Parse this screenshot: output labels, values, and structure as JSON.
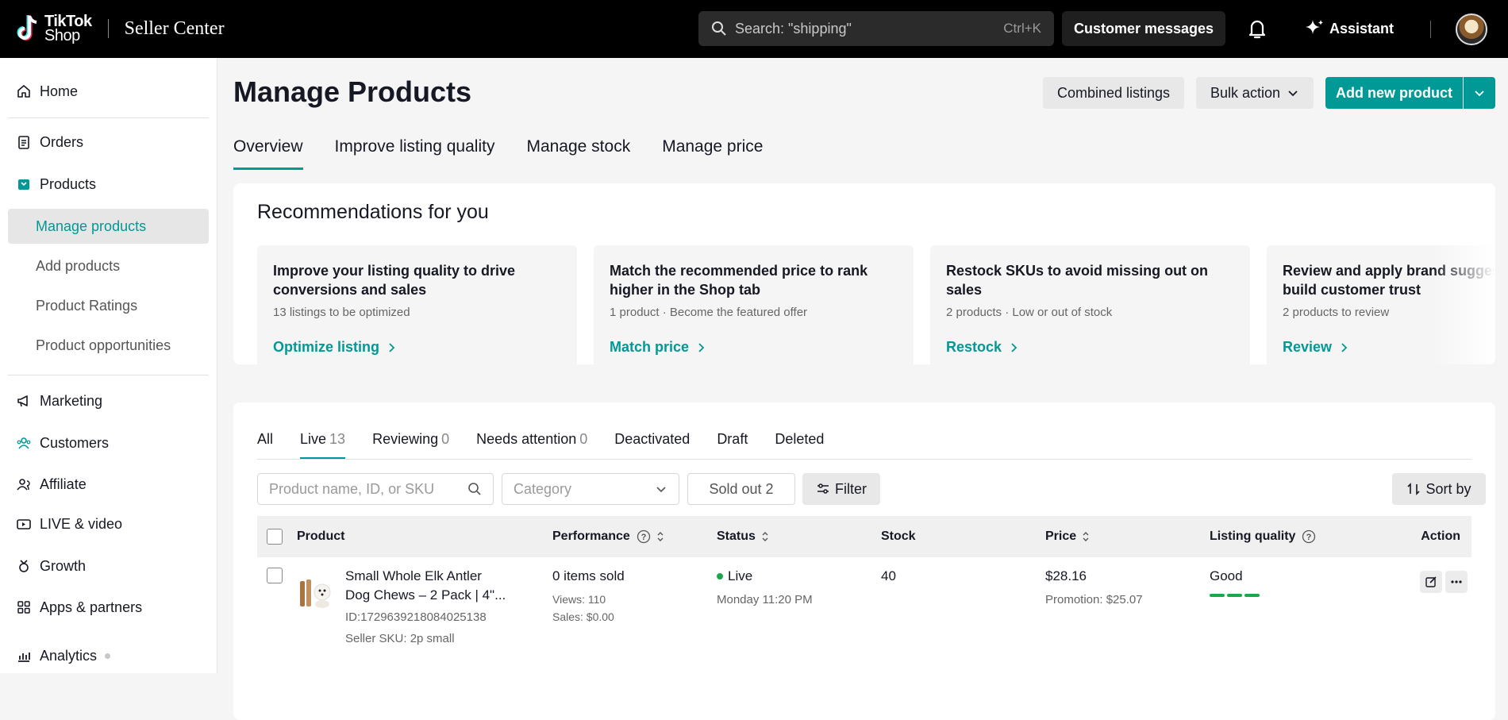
{
  "brand": {
    "logo_name": "TikTok",
    "logo_sub": "Shop",
    "app_name": "Seller Center",
    "accent": "#009995"
  },
  "topbar": {
    "search_placeholder": "Search: \"shipping\"",
    "search_shortcut": "Ctrl+K",
    "customer_messages": "Customer messages",
    "assistant": "Assistant"
  },
  "sidebar": {
    "home": "Home",
    "orders": "Orders",
    "products": "Products",
    "products_sub": [
      "Manage products",
      "Add products",
      "Product Ratings",
      "Product opportunities"
    ],
    "marketing": "Marketing",
    "customers": "Customers",
    "affiliate": "Affiliate",
    "live_video": "LIVE & video",
    "growth": "Growth",
    "apps_partners": "Apps & partners",
    "analytics": "Analytics"
  },
  "page": {
    "title": "Manage Products",
    "combined_listings": "Combined listings",
    "bulk_action": "Bulk action",
    "add_new_product": "Add new product",
    "tabs": [
      "Overview",
      "Improve listing quality",
      "Manage stock",
      "Manage price"
    ]
  },
  "recommendations": {
    "title": "Recommendations for you",
    "items": [
      {
        "heading": "Improve your listing quality to drive conversions and sales",
        "sub": "13 listings to be optimized",
        "link": "Optimize listing"
      },
      {
        "heading": "Match the recommended price to rank higher in the Shop tab",
        "sub": "1 product · Become the featured offer",
        "link": "Match price"
      },
      {
        "heading": "Restock SKUs to avoid missing out on sales",
        "sub": "2 products · Low or out of stock",
        "link": "Restock"
      },
      {
        "heading": "Review and apply brand suggestions to build customer trust",
        "sub": "2 products to review",
        "link": "Review"
      }
    ]
  },
  "list": {
    "status_tabs": [
      {
        "label": "All",
        "count": ""
      },
      {
        "label": "Live",
        "count": "13"
      },
      {
        "label": "Reviewing",
        "count": "0"
      },
      {
        "label": "Needs attention",
        "count": "0"
      },
      {
        "label": "Deactivated",
        "count": ""
      },
      {
        "label": "Draft",
        "count": ""
      },
      {
        "label": "Deleted",
        "count": ""
      }
    ],
    "search_placeholder": "Product name, ID, or SKU",
    "category_placeholder": "Category",
    "sold_out": "Sold out 2",
    "filter": "Filter",
    "sort_by": "Sort by",
    "columns": {
      "product": "Product",
      "performance": "Performance",
      "status": "Status",
      "stock": "Stock",
      "price": "Price",
      "listing_quality": "Listing quality",
      "action": "Action"
    },
    "rows": [
      {
        "name_line1": "Small Whole Elk Antler",
        "name_line2": "Dog Chews – 2 Pack | 4\"...",
        "id": "ID:1729639218084025138",
        "sku": "Seller SKU: 2p small",
        "items_sold": "0 items sold",
        "views": "Views: 110",
        "sales": "Sales: $0.00",
        "status": "Live",
        "status_time": "Monday 11:20 PM",
        "stock": "40",
        "price": "$28.16",
        "promotion": "Promotion: $25.07",
        "quality": "Good"
      }
    ]
  }
}
